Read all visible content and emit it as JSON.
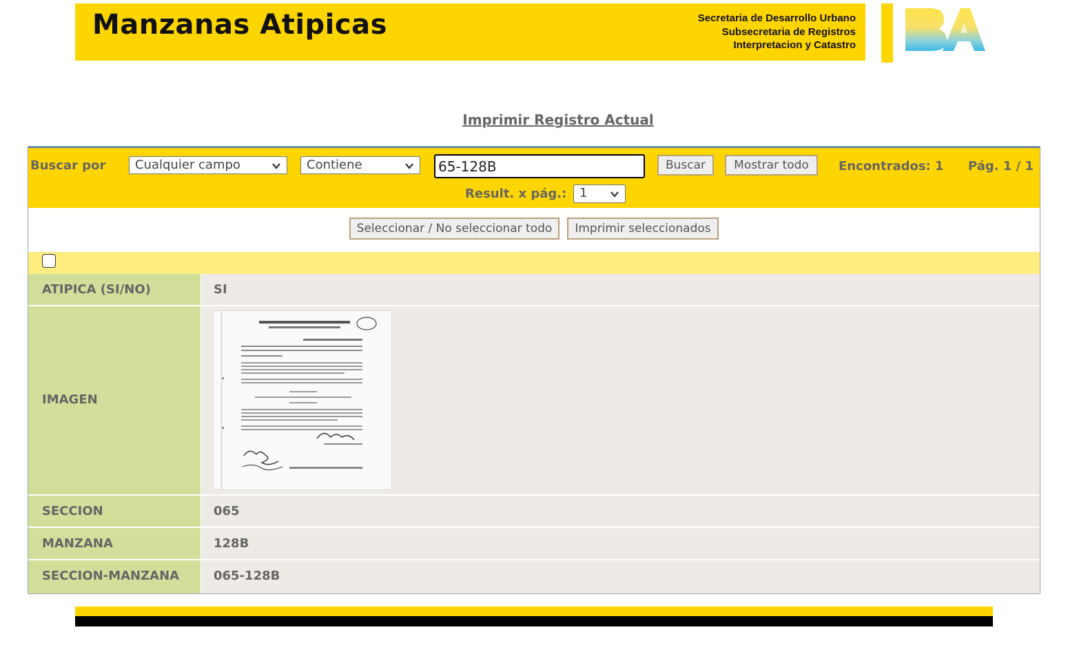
{
  "header": {
    "title": "Manzanas Atipicas",
    "org_lines": [
      "Secretaria de Desarrollo Urbano",
      "Subsecretaria de Registros",
      "Interpretacion y Catastro"
    ],
    "logo_text": "BA",
    "brand_yellow": "#FFD500"
  },
  "print_link": "Imprimir Registro Actual",
  "search": {
    "label": "Buscar por",
    "field_value": "Cualquier campo",
    "operator_value": "Contiene",
    "query": "65-128B",
    "search_button": "Buscar",
    "show_all_button": "Mostrar todo",
    "found": "Encontrados: 1",
    "page": "Pág. 1 / 1",
    "per_page_label": "Result. x pág.:",
    "per_page_value": "1"
  },
  "actions": {
    "select_all": "Seleccionar / No seleccionar todo",
    "print_selected": "Imprimir seleccionados"
  },
  "record": {
    "atipica": {
      "label": "ATIPICA (SI/NO)",
      "value": "SI"
    },
    "imagen": {
      "label": "IMAGEN"
    },
    "seccion": {
      "label": "SECCION",
      "value": "065"
    },
    "manzana": {
      "label": "MANZANA",
      "value": "128B"
    },
    "seccion_manzana": {
      "label": "SECCION-MANZANA",
      "value": "065-128B"
    }
  }
}
